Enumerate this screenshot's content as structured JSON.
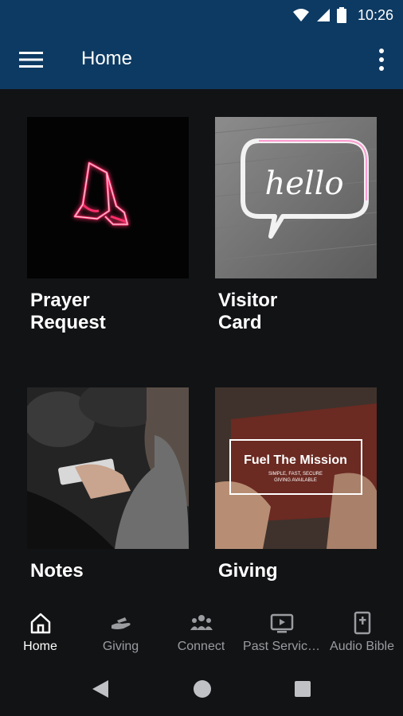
{
  "status": {
    "time": "10:26"
  },
  "appbar": {
    "title": "Home"
  },
  "tiles": [
    {
      "label": "Prayer Request"
    },
    {
      "label": "Visitor Card",
      "image_text": "hello"
    },
    {
      "label": "Notes"
    },
    {
      "label": "Giving",
      "image_title": "Fuel The Mission",
      "image_subtitle": "SIMPLE, FAST, SECURE",
      "image_subtitle2": "GIVING AVAILABLE"
    }
  ],
  "bottom_nav": [
    {
      "label": "Home",
      "icon": "home-icon",
      "active": true
    },
    {
      "label": "Giving",
      "icon": "giving-icon"
    },
    {
      "label": "Connect",
      "icon": "connect-icon"
    },
    {
      "label": "Past Servic…",
      "icon": "past-services-icon"
    },
    {
      "label": "Audio Bible",
      "icon": "audio-bible-icon"
    }
  ],
  "colors": {
    "appbar": "#0d3a62",
    "background": "#121315",
    "inactive": "#9a9ca0"
  }
}
